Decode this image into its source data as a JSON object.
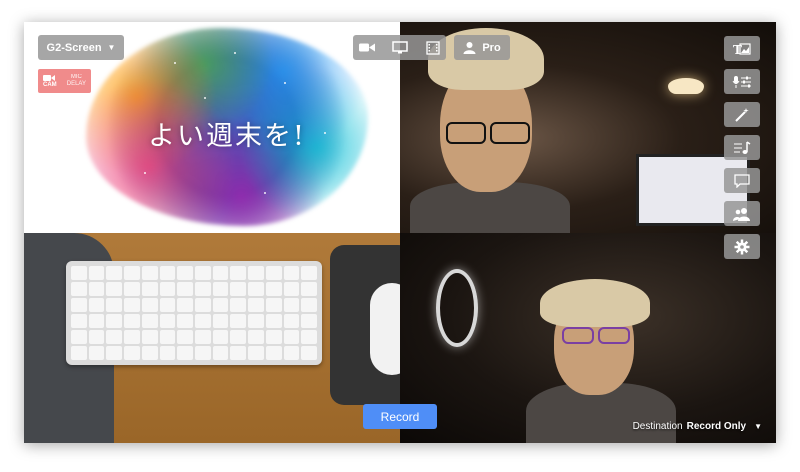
{
  "source_selector": {
    "label": "G2-Screen",
    "icon": "chevron-down-icon"
  },
  "cam_badge": {
    "cam_label": "CAM",
    "mic_label": "MIC\nDELAY"
  },
  "view_toolbar": {
    "icons": [
      "camera-icon",
      "monitor-icon",
      "film-icon"
    ]
  },
  "plan": {
    "label": "Pro",
    "icon": "user-icon"
  },
  "side_toolbar": {
    "icons": [
      "title-image-icon",
      "mic-settings-icon",
      "magic-wand-icon",
      "music-list-icon",
      "chat-icon",
      "guests-icon",
      "gear-icon"
    ]
  },
  "slide": {
    "greeting": "よい週末を!"
  },
  "record_button": {
    "label": "Record"
  },
  "destination": {
    "label": "Destination",
    "value": "Record Only"
  },
  "colors": {
    "record_blue": "#4f8ef7",
    "cam_badge_red": "#f08b8b",
    "control_gray": "#969696"
  }
}
